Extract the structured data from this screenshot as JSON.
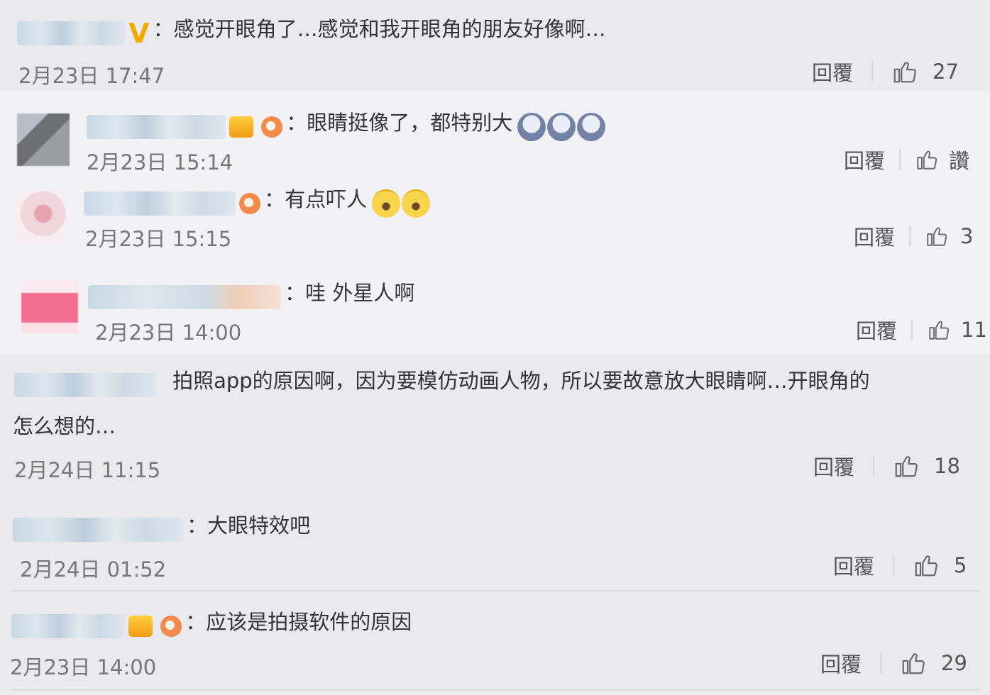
{
  "comments": [
    {
      "id": "c1",
      "text": "感觉开眼角了…感觉和我开眼角的朋友好像啊…",
      "time": "2月23日 17:47",
      "reply_label": "回覆",
      "likes": "27",
      "badge": "V"
    },
    {
      "id": "r1",
      "text": "眼睛挺像了，都特别大",
      "time": "2月23日 15:14",
      "reply_label": "回覆",
      "likes": "讚",
      "emojis": [
        "scared-face-icon",
        "scared-face-icon",
        "scared-face-icon"
      ]
    },
    {
      "id": "r2",
      "text": "有点吓人",
      "time": "2月23日 15:15",
      "reply_label": "回覆",
      "likes": "3",
      "emojis": [
        "crying-laughing-icon",
        "crying-laughing-icon"
      ]
    },
    {
      "id": "r3",
      "text": "哇 外星人啊",
      "time": "2月23日 14:00",
      "reply_label": "回覆",
      "likes": "11"
    },
    {
      "id": "c2",
      "text_line1": "拍照app的原因啊，因为要模仿动画人物，所以要故意放大眼睛啊…开眼角的",
      "text_line2": "怎么想的…",
      "time": "2月24日 11:15",
      "reply_label": "回覆",
      "likes": "18"
    },
    {
      "id": "c3",
      "text": "大眼特效吧",
      "time": "2月24日 01:52",
      "reply_label": "回覆",
      "likes": "5"
    },
    {
      "id": "c4",
      "text": "应该是拍摄软件的原因",
      "time": "2月23日 14:00",
      "reply_label": "回覆",
      "likes": "29"
    }
  ],
  "colon": "："
}
